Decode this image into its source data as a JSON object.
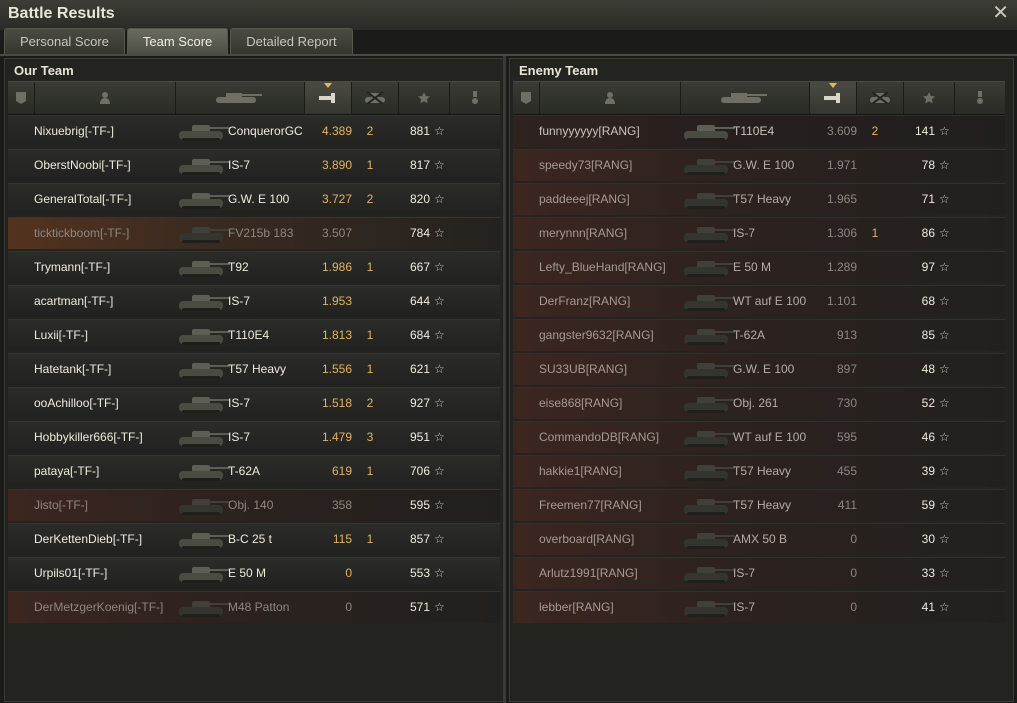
{
  "window": {
    "title": "Battle Results",
    "close_glyph": "✕"
  },
  "tabs": [
    {
      "label": "Personal Score",
      "active": false
    },
    {
      "label": "Team Score",
      "active": true
    },
    {
      "label": "Detailed Report",
      "active": false
    }
  ],
  "our_team": {
    "title": "Our Team",
    "columns": [
      "platoon-icon",
      "player-icon",
      "tank-icon",
      "damage-icon",
      "kills-icon",
      "star-icon",
      "medal-icon"
    ],
    "star_glyph": "☆",
    "rows": [
      {
        "name": "Nixuebrig[-TF-]",
        "tank": "ConquerorGC",
        "damage": "4.389",
        "kills": "2",
        "xp": "881",
        "state": "alive"
      },
      {
        "name": "OberstNoobi[-TF-]",
        "tank": "IS-7",
        "damage": "3.890",
        "kills": "1",
        "xp": "817",
        "state": "alive"
      },
      {
        "name": "GeneralTotal[-TF-]",
        "tank": "G.W. E 100",
        "damage": "3.727",
        "kills": "2",
        "xp": "820",
        "state": "alive"
      },
      {
        "name": "ticktickboom[-TF-]",
        "tank": "FV215b 183",
        "damage": "3.507",
        "kills": "",
        "xp": "784",
        "state": "self-dead"
      },
      {
        "name": "Trymann[-TF-]",
        "tank": "T92",
        "damage": "1.986",
        "kills": "1",
        "xp": "667",
        "state": "alive"
      },
      {
        "name": "acartman[-TF-]",
        "tank": "IS-7",
        "damage": "1.953",
        "kills": "",
        "xp": "644",
        "state": "alive"
      },
      {
        "name": "Luxii[-TF-]",
        "tank": "T110E4",
        "damage": "1.813",
        "kills": "1",
        "xp": "684",
        "state": "alive"
      },
      {
        "name": "Hatetank[-TF-]",
        "tank": "T57 Heavy",
        "damage": "1.556",
        "kills": "1",
        "xp": "621",
        "state": "alive"
      },
      {
        "name": "ooAchilloo[-TF-]",
        "tank": "IS-7",
        "damage": "1.518",
        "kills": "2",
        "xp": "927",
        "state": "alive"
      },
      {
        "name": "Hobbykiller666[-TF-]",
        "tank": "IS-7",
        "damage": "1.479",
        "kills": "3",
        "xp": "951",
        "state": "alive"
      },
      {
        "name": "pataya[-TF-]",
        "tank": "T-62A",
        "damage": "619",
        "kills": "1",
        "xp": "706",
        "state": "alive"
      },
      {
        "name": "Jisto[-TF-]",
        "tank": "Obj. 140",
        "damage": "358",
        "kills": "",
        "xp": "595",
        "state": "dead"
      },
      {
        "name": "DerKettenDieb[-TF-]",
        "tank": "B-C 25 t",
        "damage": "115",
        "kills": "1",
        "xp": "857",
        "state": "alive"
      },
      {
        "name": "Urpils01[-TF-]",
        "tank": "E 50 M",
        "damage": "0",
        "kills": "",
        "xp": "553",
        "state": "alive"
      },
      {
        "name": "DerMetzgerKoenig[-TF-]",
        "tank": "M48 Patton",
        "damage": "0",
        "kills": "",
        "xp": "571",
        "state": "dead"
      }
    ]
  },
  "enemy_team": {
    "title": "Enemy Team",
    "star_glyph": "☆",
    "rows": [
      {
        "name": "funnyyyyyy[RANG]",
        "tank": "T110E4",
        "damage": "3.609",
        "kills": "2",
        "xp": "141",
        "state": "alive"
      },
      {
        "name": "speedy73[RANG]",
        "tank": "G.W. E 100",
        "damage": "1.971",
        "kills": "",
        "xp": "78",
        "state": "dead"
      },
      {
        "name": "paddeeej[RANG]",
        "tank": "T57 Heavy",
        "damage": "1.965",
        "kills": "",
        "xp": "71",
        "state": "dead"
      },
      {
        "name": "merynnn[RANG]",
        "tank": "IS-7",
        "damage": "1.306",
        "kills": "1",
        "xp": "86",
        "state": "dead"
      },
      {
        "name": "Lefty_BlueHand[RANG]",
        "tank": "E 50 M",
        "damage": "1.289",
        "kills": "",
        "xp": "97",
        "state": "dead"
      },
      {
        "name": "DerFranz[RANG]",
        "tank": "WT auf E 100",
        "damage": "1.101",
        "kills": "",
        "xp": "68",
        "state": "dead"
      },
      {
        "name": "gangster9632[RANG]",
        "tank": "T-62A",
        "damage": "913",
        "kills": "",
        "xp": "85",
        "state": "dead"
      },
      {
        "name": "SU33UB[RANG]",
        "tank": "G.W. E 100",
        "damage": "897",
        "kills": "",
        "xp": "48",
        "state": "dead"
      },
      {
        "name": "eise868[RANG]",
        "tank": "Obj. 261",
        "damage": "730",
        "kills": "",
        "xp": "52",
        "state": "dead"
      },
      {
        "name": "CommandoDB[RANG]",
        "tank": "WT auf E 100",
        "damage": "595",
        "kills": "",
        "xp": "46",
        "state": "dead"
      },
      {
        "name": "hakkie1[RANG]",
        "tank": "T57 Heavy",
        "damage": "455",
        "kills": "",
        "xp": "39",
        "state": "dead"
      },
      {
        "name": "Freemen77[RANG]",
        "tank": "T57 Heavy",
        "damage": "411",
        "kills": "",
        "xp": "59",
        "state": "dead"
      },
      {
        "name": "overboard[RANG]",
        "tank": "AMX 50 B",
        "damage": "0",
        "kills": "",
        "xp": "30",
        "state": "dead"
      },
      {
        "name": "Arlutz1991[RANG]",
        "tank": "IS-7",
        "damage": "0",
        "kills": "",
        "xp": "33",
        "state": "dead"
      },
      {
        "name": "lebber[RANG]",
        "tank": "IS-7",
        "damage": "0",
        "kills": "",
        "xp": "41",
        "state": "dead"
      }
    ]
  },
  "colors": {
    "accent": "#e3b459",
    "our_row": "#2b2c28",
    "enemy_row": "#2f2320",
    "self_dead_row": "#53331f"
  }
}
